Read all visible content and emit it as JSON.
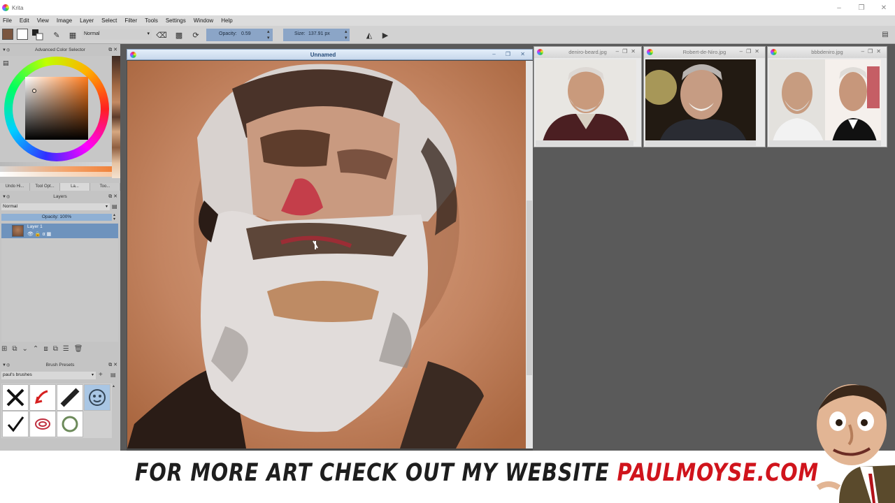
{
  "window": {
    "title": "Krita",
    "buttons": [
      "–",
      "❐",
      "✕"
    ]
  },
  "menu": [
    "File",
    "Edit",
    "View",
    "Image",
    "Layer",
    "Select",
    "Filter",
    "Tools",
    "Settings",
    "Window",
    "Help"
  ],
  "toolbar": {
    "blend_mode": "Normal",
    "opacity_label": "Opacity:",
    "opacity_value": "0.59",
    "size_label": "Size:",
    "size_value": "137.91 px"
  },
  "dockers": {
    "color_selector_title": "Advanced Color Selector",
    "tabs": [
      "Undo Hi...",
      "Tool Opt...",
      "La...",
      "Too..."
    ],
    "layers_title": "Layers",
    "layer_blend": "Normal",
    "layer_opacity": "Opacity:  100%",
    "layer_name": "Layer 1",
    "brush_presets_title": "Brush Presets",
    "preset_tag": "paul's brushes"
  },
  "canvas": {
    "title": "Unnamed"
  },
  "references": [
    {
      "title": "deniro-beard.jpg"
    },
    {
      "title": "Robert-de-Niro.jpg"
    },
    {
      "title": "bbbdeniro.jpg"
    }
  ],
  "banner": {
    "text": "FOR MORE ART CHECK OUT MY WEBSITE ",
    "site": "PAULMOYSE.COM"
  },
  "colors": {
    "accent": "#6e93bd",
    "banner_red": "#d0141c",
    "canvas_bg": "#c48a64"
  }
}
